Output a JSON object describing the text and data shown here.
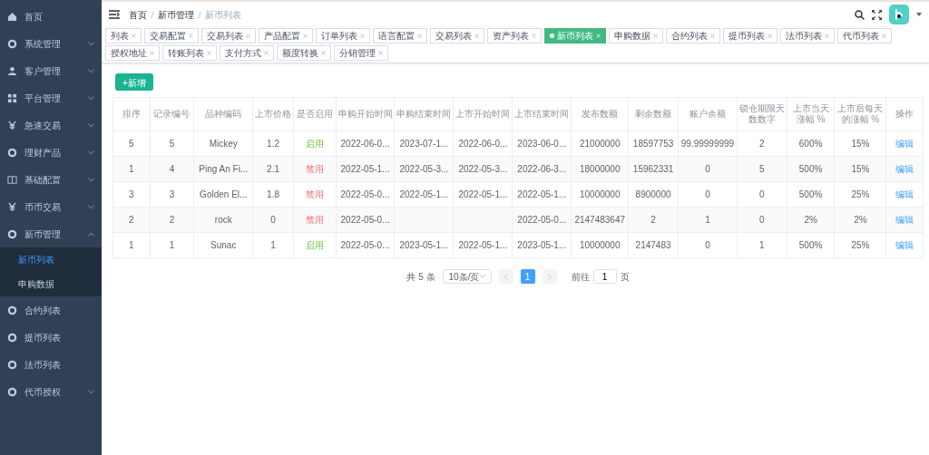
{
  "sidebar": {
    "items": [
      {
        "label": "首页"
      },
      {
        "label": "系统管理",
        "expanded": false
      },
      {
        "label": "客户管理",
        "expanded": false
      },
      {
        "label": "平台管理",
        "expanded": false
      },
      {
        "label": "急速交易",
        "expanded": false
      },
      {
        "label": "理财产品",
        "expanded": false
      },
      {
        "label": "基础配置",
        "expanded": false
      },
      {
        "label": "币币交易",
        "expanded": false
      },
      {
        "label": "新币管理",
        "expanded": true,
        "children": [
          {
            "label": "新币列表",
            "selected": true
          },
          {
            "label": "申购数据",
            "selected": false
          }
        ]
      },
      {
        "label": "合约列表"
      },
      {
        "label": "提币列表"
      },
      {
        "label": "法币列表"
      },
      {
        "label": "代币授权",
        "expanded": false
      }
    ]
  },
  "breadcrumb": [
    "首页",
    "新币管理",
    "新币列表"
  ],
  "tabs": [
    {
      "label": "列表",
      "selected": false
    },
    {
      "label": "交易配置",
      "selected": false
    },
    {
      "label": "交易列表",
      "selected": false
    },
    {
      "label": "产品配置",
      "selected": false
    },
    {
      "label": "订单列表",
      "selected": false
    },
    {
      "label": "语言配置",
      "selected": false
    },
    {
      "label": "交易列表",
      "selected": false
    },
    {
      "label": "资产列表",
      "selected": false
    },
    {
      "label": "新币列表",
      "selected": true
    },
    {
      "label": "申购数据",
      "selected": false
    },
    {
      "label": "合约列表",
      "selected": false
    },
    {
      "label": "提币列表",
      "selected": false
    },
    {
      "label": "法币列表",
      "selected": false
    },
    {
      "label": "代币列表",
      "selected": false
    },
    {
      "label": "授权地址",
      "selected": false
    },
    {
      "label": "转账列表",
      "selected": false
    },
    {
      "label": "支付方式",
      "selected": false
    },
    {
      "label": "额度转换",
      "selected": false
    },
    {
      "label": "分销管理",
      "selected": false
    }
  ],
  "add_button": "+新增",
  "table": {
    "columns": [
      "排序",
      "记录编号",
      "品种编码",
      "上市价格",
      "是否启用",
      "申购开始时间",
      "申购结束时间",
      "上市开始时间",
      "上市结束时间",
      "发布数额",
      "剩余数额",
      "账户余额",
      "锁仓期限天数数字",
      "上市当天涨幅 %",
      "上市后每天的涨幅 %",
      "操作"
    ],
    "rows": [
      {
        "cells": [
          "5",
          "5",
          "Mickey",
          "1.2",
          "启用",
          "2022-06-0...",
          "2023-07-1...",
          "2022-06-0...",
          "2023-06-0...",
          "21000000",
          "18597753",
          "99.99999999",
          "2",
          "600%",
          "15%",
          "编辑"
        ],
        "enabled": true
      },
      {
        "cells": [
          "1",
          "4",
          "Ping An Fi...",
          "2.1",
          "禁用",
          "2022-05-1...",
          "2022-05-3...",
          "2022-05-3...",
          "2022-06-3...",
          "18000000",
          "15962331",
          "0",
          "5",
          "500%",
          "15%",
          "编辑"
        ],
        "enabled": false
      },
      {
        "cells": [
          "3",
          "3",
          "Golden El...",
          "1.8",
          "禁用",
          "2022-05-0...",
          "2022-05-1...",
          "2022-05-1...",
          "2022-05-1...",
          "10000000",
          "8900000",
          "0",
          "0",
          "500%",
          "25%",
          "编辑"
        ],
        "enabled": false
      },
      {
        "cells": [
          "2",
          "2",
          "rock",
          "0",
          "禁用",
          "2022-05-0...",
          null,
          null,
          "2022-05-0...",
          "2147483647",
          "2",
          "1",
          "0",
          "2%",
          "2%",
          "编辑"
        ],
        "enabled": false
      },
      {
        "cells": [
          "1",
          "1",
          "Sunac",
          "1",
          "启用",
          "2022-05-0...",
          "2023-05-1...",
          "2022-05-1...",
          "2023-05-1...",
          "10000000",
          "2147483",
          "0",
          "1",
          "500%",
          "25%",
          "编辑"
        ],
        "enabled": true
      }
    ]
  },
  "pagination": {
    "total": "共 5 条",
    "page_size": "10条/页",
    "pages": [
      {
        "label": "1",
        "selected": true
      }
    ],
    "goto_label": "前往",
    "goto_value": "1",
    "goto_suffix": "页"
  }
}
